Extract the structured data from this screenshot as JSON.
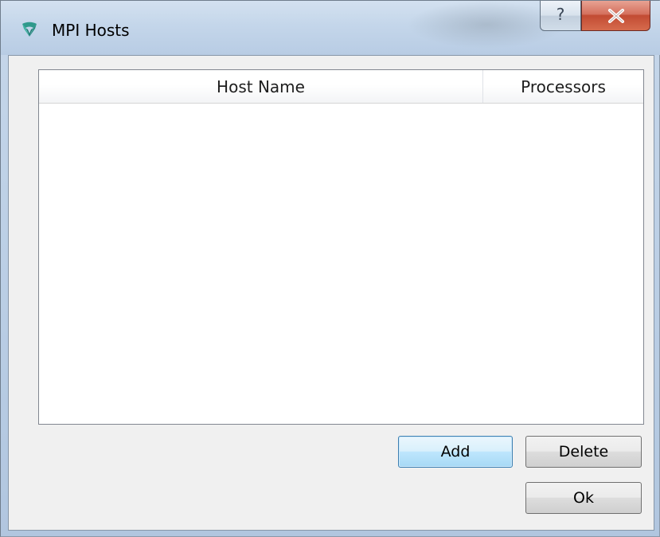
{
  "window": {
    "title": "MPI Hosts",
    "help_label": "?",
    "close_label": "X"
  },
  "table": {
    "columns": [
      "Host Name",
      "Processors"
    ],
    "rows": []
  },
  "buttons": {
    "add": "Add",
    "delete": "Delete",
    "ok": "Ok"
  },
  "icons": {
    "app": "mpi-app-icon",
    "help": "question-mark-icon",
    "close": "close-x-icon"
  },
  "colors": {
    "close_red": "#c24b33",
    "default_button_blue": "#3c7fb1",
    "dialog_background": "#f0f0f0"
  }
}
